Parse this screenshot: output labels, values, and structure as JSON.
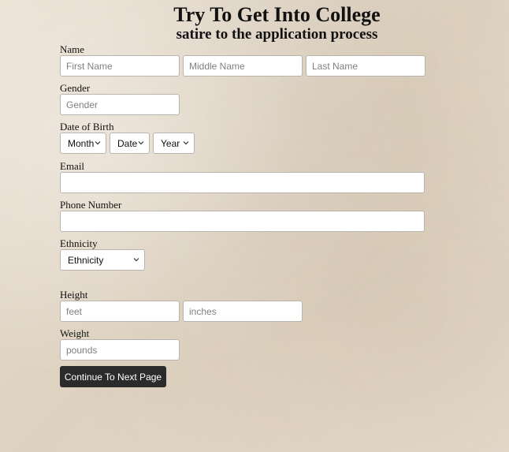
{
  "header": {
    "title": "Try To Get Into College",
    "subtitle": "satire to the application process"
  },
  "form": {
    "name": {
      "label": "Name",
      "first_placeholder": "First Name",
      "middle_placeholder": "Middle Name",
      "last_placeholder": "Last Name"
    },
    "gender": {
      "label": "Gender",
      "placeholder": "Gender"
    },
    "dob": {
      "label": "Date of Birth",
      "month": "Month",
      "date": "Date",
      "year": "Year"
    },
    "email": {
      "label": "Email",
      "value": ""
    },
    "phone": {
      "label": "Phone Number",
      "value": ""
    },
    "ethnicity": {
      "label": "Ethnicity",
      "selected": "Ethnicity"
    },
    "height": {
      "label": "Height",
      "feet_placeholder": "feet",
      "inches_placeholder": "inches"
    },
    "weight": {
      "label": "Weight",
      "placeholder": "pounds"
    },
    "continue_label": "Continue To Next Page"
  },
  "icons": {
    "select_chevron": "chevron-down-icon"
  },
  "colors": {
    "button_bg": "#2b2b2b",
    "button_text": "#ffffff",
    "page_bg": "#e6dbcb"
  }
}
